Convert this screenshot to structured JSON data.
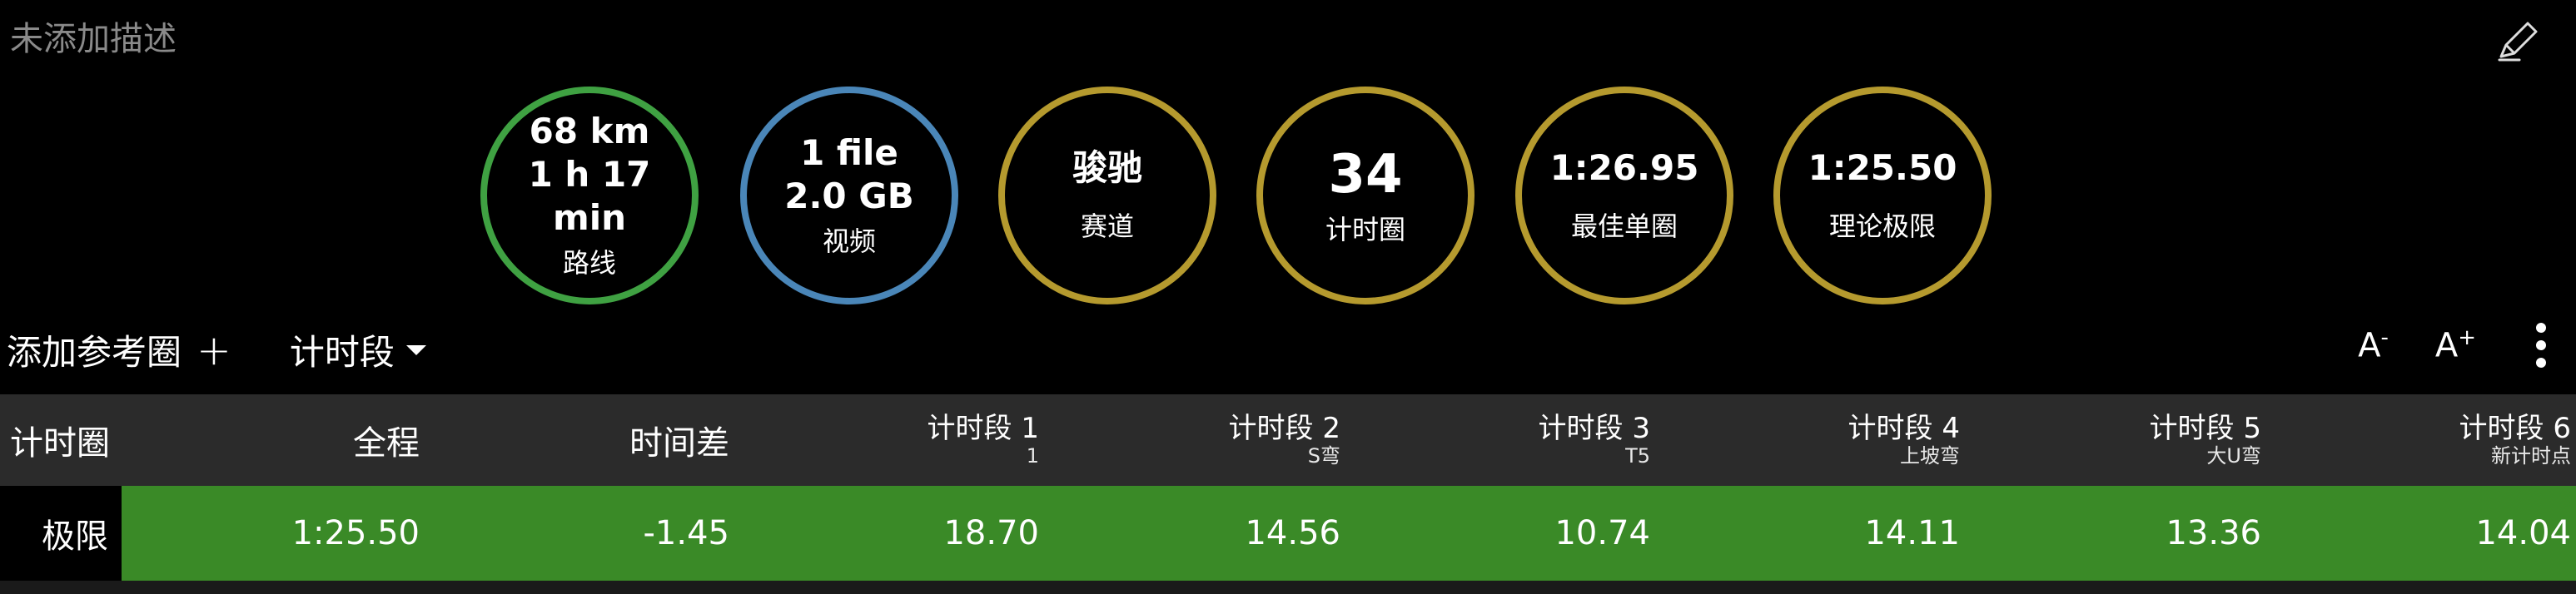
{
  "header": {
    "description": "未添加描述",
    "edit_icon": "pencil-icon"
  },
  "stats": [
    {
      "line1": "68 km",
      "line2": "1 h 17 min",
      "label": "路线",
      "color": "#3fa142"
    },
    {
      "line1": "1 file",
      "line2": "2.0 GB",
      "label": "视频",
      "color": "#4a86b8"
    },
    {
      "line1": "骏驰",
      "label": "赛道",
      "color": "#b59a2e"
    },
    {
      "value": "34",
      "label": "计时圈",
      "color": "#b59a2e"
    },
    {
      "line1": "1:26.95",
      "label": "最佳单圈",
      "color": "#b59a2e"
    },
    {
      "line1": "1:25.50",
      "label": "理论极限",
      "color": "#b59a2e"
    }
  ],
  "toolbar": {
    "add_reference_lap": "添加参考圈",
    "segment_select": "计时段",
    "font_decrease": "A",
    "font_decrease_sup": "-",
    "font_increase": "A",
    "font_increase_sup": "+",
    "more_icon": "more-vertical-icon"
  },
  "table": {
    "headers": {
      "lap": "计时圈",
      "full": "全程",
      "delta": "时间差",
      "segments": [
        {
          "name": "计时段 1",
          "sub": "1"
        },
        {
          "name": "计时段 2",
          "sub": "S弯"
        },
        {
          "name": "计时段 3",
          "sub": "T5"
        },
        {
          "name": "计时段 4",
          "sub": "上坡弯"
        },
        {
          "name": "计时段 5",
          "sub": "大U弯"
        },
        {
          "name": "计时段 6",
          "sub": "新计时点"
        }
      ]
    },
    "row": {
      "lap": "极限",
      "full": "1:25.50",
      "delta": "-1.45",
      "segments": [
        "18.70",
        "14.56",
        "10.74",
        "14.11",
        "13.36",
        "14.04"
      ],
      "highlight_color": "#3a8a27"
    }
  }
}
